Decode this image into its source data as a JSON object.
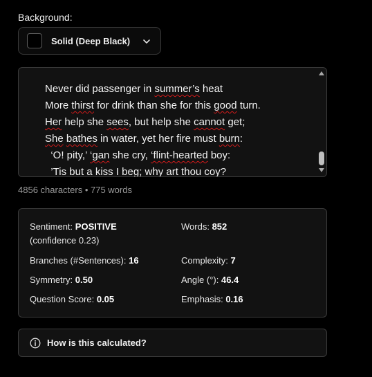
{
  "background": {
    "label": "Background:",
    "selected_option": "Solid (Deep Black)",
    "swatch_color": "#000000",
    "chevron_icon": "chevron-down-icon"
  },
  "editor": {
    "lines": [
      [
        "",
        {
          "t": "Never"
        },
        " did passenger in ",
        {
          "t": "summer's",
          "sq": true
        },
        " heat"
      ],
      [
        "More ",
        {
          "t": "thirst",
          "sq": true
        },
        " for drink than she for this ",
        {
          "t": "good",
          "sq": true
        },
        " turn."
      ],
      [
        {
          "t": "Her",
          "sq": true
        },
        " help she ",
        {
          "t": "sees",
          "sq": true
        },
        ", but help she ",
        {
          "t": "cannot",
          "sq": true
        },
        " get;"
      ],
      [
        {
          "t": "She",
          "sq": true
        },
        " ",
        {
          "t": "bathes",
          "sq": true
        },
        " in water, yet her fire must ",
        {
          "t": "burn",
          "sq": true
        },
        ":"
      ],
      [
        "  ",
        {
          "t": "'O! pity,'",
          "sq": true
        },
        " ",
        {
          "t": "'gan",
          "sq": true
        },
        " she cry, ",
        {
          "t": "'flint-hearted",
          "sq": true
        },
        " boy:"
      ],
      [
        "  ",
        {
          "t": "'Tis",
          "sq": true
        },
        " but a kiss I ",
        {
          "t": "beg",
          "sq": true
        },
        "; why art thou ",
        {
          "t": "coy",
          "sq": true
        },
        "?"
      ]
    ],
    "plain_text": "Never did passenger in summer’s heat\nMore thirst for drink than she for this good turn.\nHer help she sees, but help she cannot get;\nShe bathes in water, yet her fire must burn:\n  ‘O! pity,’ ‘gan she cry, ‘flint-hearted boy:\n  ’Tis but a kiss I beg; why art thou coy?"
  },
  "counts": "4856 characters • 775 words",
  "stats": {
    "sentiment_label": "Sentiment:",
    "sentiment_value": "POSITIVE",
    "sentiment_confidence": "(confidence 0.23)",
    "words_label": "Words:",
    "words_value": "852",
    "branches_label": "Branches (#Sentences):",
    "branches_value": "16",
    "complexity_label": "Complexity:",
    "complexity_value": "7",
    "symmetry_label": "Symmetry:",
    "symmetry_value": "0.50",
    "angle_label": "Angle (°):",
    "angle_value": "46.4",
    "question_label": "Question Score:",
    "question_value": "0.05",
    "emphasis_label": "Emphasis:",
    "emphasis_value": "0.16"
  },
  "help": {
    "label": "How is this calculated?",
    "icon": "info-icon"
  },
  "colors": {
    "page_bg": "#000000",
    "panel_bg": "#121212",
    "border": "#3a3a3a",
    "spell_underline": "#d11a1a",
    "muted_text": "#9a9a9a"
  }
}
